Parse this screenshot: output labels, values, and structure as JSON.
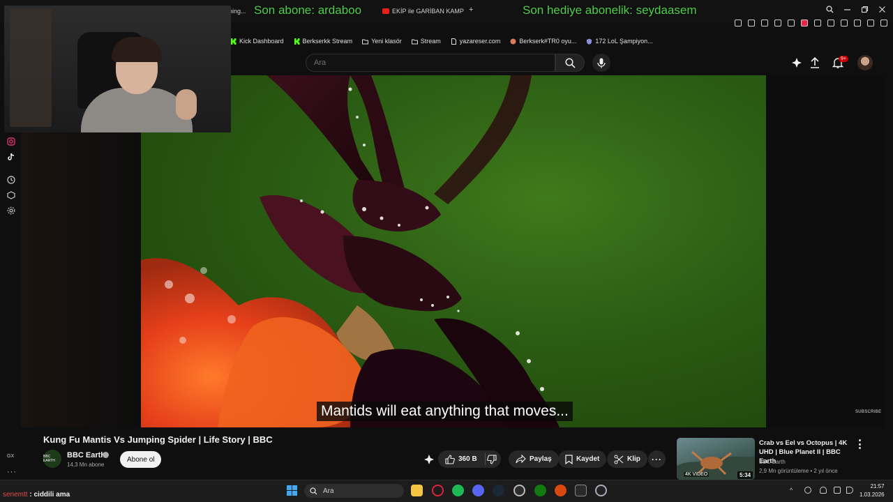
{
  "browser": {
    "tabs": [
      {
        "label": "t Smashing...",
        "icon": "tab-favicon"
      },
      {
        "label": "EKİP ile GARİBAN KAMP Y...",
        "icon": "youtube-favicon"
      }
    ],
    "new_tab_label": "+",
    "window_controls": [
      "search-icon",
      "minimize-icon",
      "restore-icon",
      "close-icon"
    ],
    "bookmarks": [
      {
        "label": "Kick Dashboard",
        "icon": "kick-icon",
        "color": "#53fc18"
      },
      {
        "label": "Berkserkk Stream",
        "icon": "kick-icon",
        "color": "#53fc18"
      },
      {
        "label": "Yeni klasör",
        "icon": "folder-icon",
        "color": "#dddddd"
      },
      {
        "label": "Stream",
        "icon": "folder-icon",
        "color": "#dddddd"
      },
      {
        "label": "yazareser.com",
        "icon": "page-icon",
        "color": "#dddddd"
      },
      {
        "label": "Berkserk#TR0 oyu...",
        "icon": "globe-icon",
        "color": "#e07a5f"
      },
      {
        "label": "172 LoL Şampiyon...",
        "icon": "shield-icon",
        "color": "#8a8fd8"
      }
    ]
  },
  "stream_overlay": {
    "last_sub": "Son abone: ardaboo",
    "last_gift_sub": "Son hediye abonelik: seydaasem",
    "accent": "#4fd14a"
  },
  "youtube": {
    "search": {
      "placeholder": "Ara"
    },
    "notification_badge": "9+",
    "video": {
      "caption": "Mantids will eat anything that moves...",
      "watermark": "SUBSCRIBE",
      "title": "Kung Fu Mantis Vs Jumping Spider | Life Story | BBC",
      "channel": {
        "name": "BBC Earth",
        "subscribers": "14,3 Mn abone",
        "avatar_text": "BBC EARTH"
      },
      "subscribe_label": "Abone ol",
      "actions": {
        "likes": "360 B",
        "share": "Paylaş",
        "save": "Kaydet",
        "clip": "Klip"
      }
    },
    "related": [
      {
        "title": "Crab vs Eel vs Octopus | 4K UHD | Blue Planet II | BBC Earth",
        "channel": "BBC Earth",
        "meta": "2,9 Mn görüntüleme • 2 yıl önce",
        "duration": "5:34",
        "badge": "4K VIDEO"
      }
    ]
  },
  "chat": {
    "user": "senemtt",
    "separator": ":",
    "message": "ciddili ama",
    "user_color": "#e14c4c"
  },
  "taskbar": {
    "search_placeholder": "Ara",
    "clock_time": "21:57",
    "clock_date": "1.03.2026",
    "left_label": "GX"
  }
}
